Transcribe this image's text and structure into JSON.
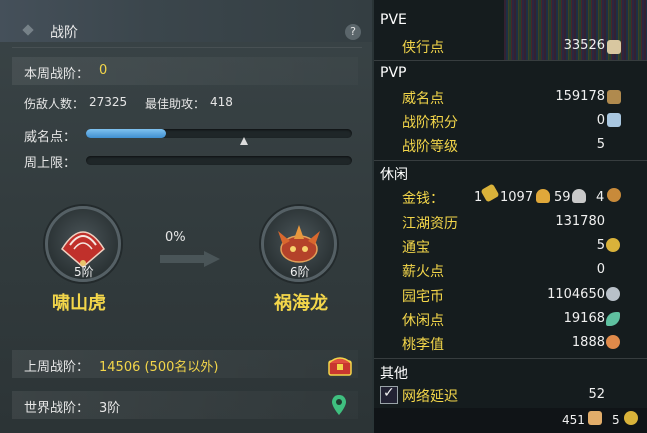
{
  "left": {
    "title": "战阶",
    "help": "?",
    "weekly_label": "本周战阶：",
    "weekly_value": "0",
    "kills_label": "伤敌人数：",
    "kills_value": "27325",
    "assist_label": "最佳助攻：",
    "assist_value": "418",
    "prestige_label": "威名点：",
    "prestige_progress": 0.3,
    "weekly_cap_label": "周上限：",
    "weekly_cap_progress": 0,
    "current_rank": {
      "level": "5阶",
      "name": "啸山虎"
    },
    "next_rank": {
      "level": "6阶",
      "name": "祸海龙"
    },
    "progress_pct": "0%",
    "last_week_label": "上周战阶：",
    "last_week_value": "14506 (500名以外)",
    "world_label": "世界战阶：",
    "world_value": "3阶"
  },
  "right": {
    "pve": {
      "title": "PVE",
      "items": [
        {
          "label": "侠行点",
          "value": "33526",
          "icon": "scroll-icon"
        }
      ]
    },
    "pvp": {
      "title": "PVP",
      "items": [
        {
          "label": "威名点",
          "value": "159178",
          "icon": "mask-icon"
        },
        {
          "label": "战阶积分",
          "value": "0",
          "icon": "crystal-icon"
        },
        {
          "label": "战阶等级",
          "value": "5",
          "icon": ""
        }
      ]
    },
    "leisure": {
      "title": "休闲",
      "money_label": "金钱：",
      "money_gold_ingot": "1",
      "money_gold": "1097",
      "money_silver": "59",
      "money_copper": "4",
      "items": [
        {
          "label": "江湖资历",
          "value": "131780",
          "icon": ""
        },
        {
          "label": "通宝",
          "value": "5",
          "icon": "coin-icon"
        },
        {
          "label": "薪火点",
          "value": "0",
          "icon": ""
        },
        {
          "label": "园宅币",
          "value": "1104650",
          "icon": "house-coin-icon"
        },
        {
          "label": "休闲点",
          "value": "19168",
          "icon": "leaf-icon"
        },
        {
          "label": "桃李值",
          "value": "1888",
          "icon": "peach-icon"
        }
      ]
    },
    "other": {
      "title": "其他",
      "items": [
        {
          "label": "网络延迟",
          "value": "52",
          "checked": true
        }
      ]
    },
    "bottom_left_value": "451",
    "bottom_right_value": "5"
  },
  "colors": {
    "accent_yellow": "#f3d64a",
    "bar_blue": "#4a9be0",
    "panel_bg": "#343e42"
  }
}
